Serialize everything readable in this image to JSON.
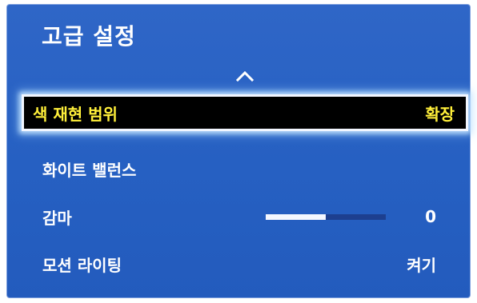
{
  "title": "고급 설정",
  "icons": {
    "scroll_up": "chevron-up-icon"
  },
  "colors": {
    "panel_background": "#2660c2",
    "selected_background": "#000000",
    "selected_text": "#ffef3a",
    "normal_text": "#ffffff",
    "slider_fill": "#f4f7ff",
    "slider_track": "#1d3f8f"
  },
  "menu": {
    "items": [
      {
        "label": "색 재현 범위",
        "value": "확장",
        "selected": true
      },
      {
        "label": "화이트 밸런스",
        "value": "",
        "selected": false
      },
      {
        "label": "감마",
        "value": "0",
        "selected": false,
        "slider_level": 0.5
      },
      {
        "label": "모션 라이팅",
        "value": "켜기",
        "selected": false
      }
    ]
  }
}
